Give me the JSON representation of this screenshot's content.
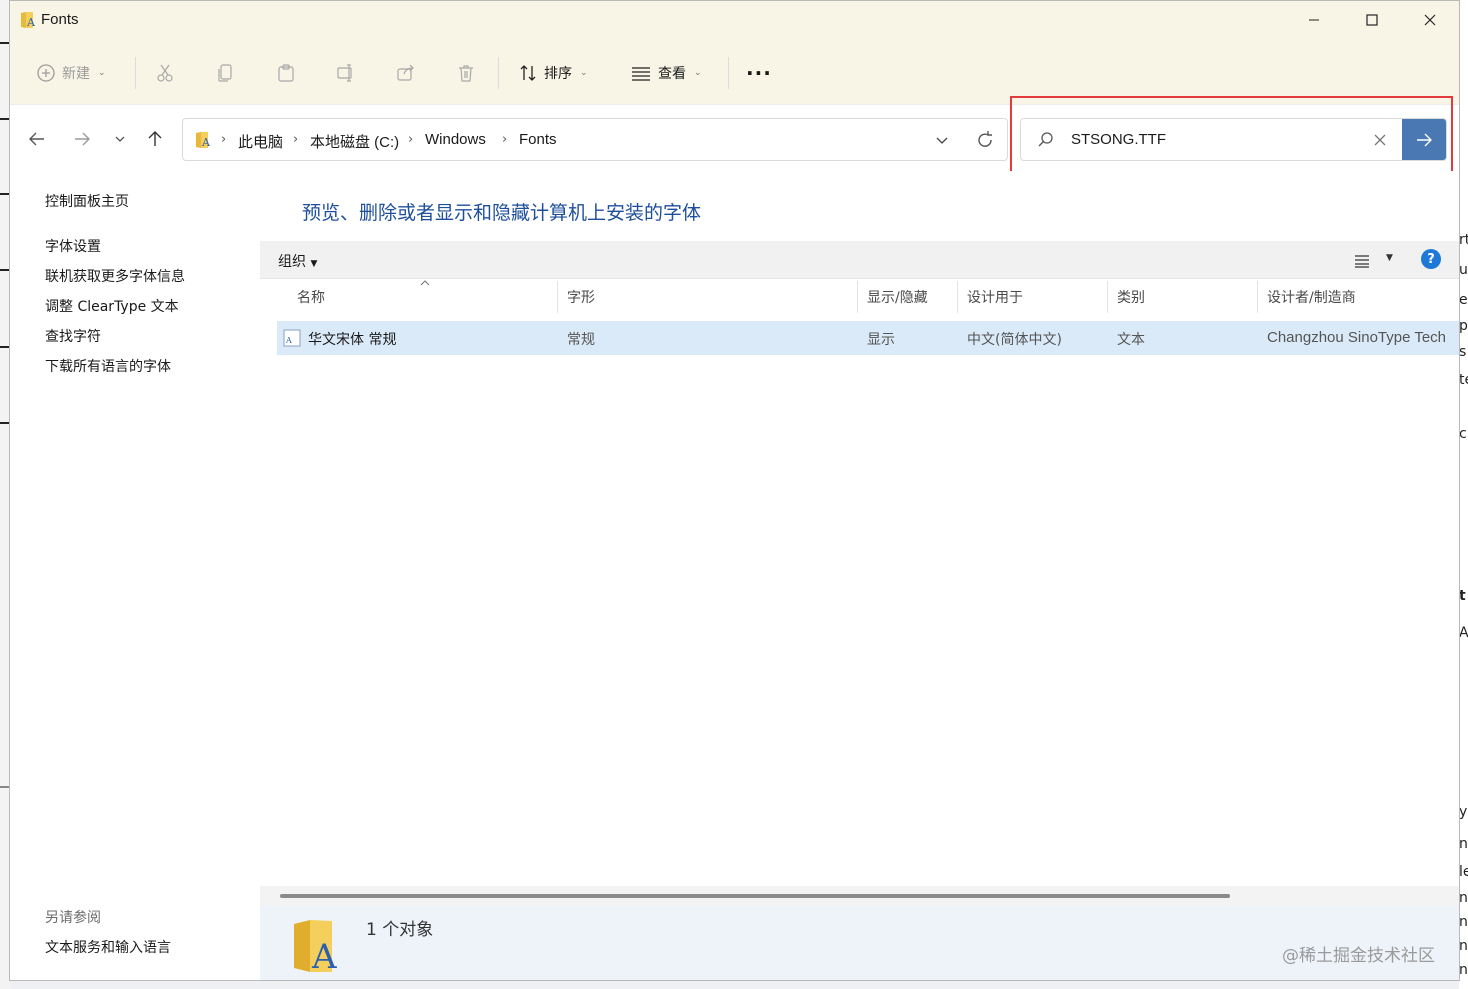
{
  "window": {
    "title": "Fonts",
    "minimize_glyph": "—",
    "maximize_glyph": "☐",
    "close_glyph": "✕"
  },
  "toolbar": {
    "new_label": "新建",
    "sort_label": "排序",
    "view_label": "查看",
    "more_glyph": "···"
  },
  "address": {
    "segments": [
      "此电脑",
      "本地磁盘 (C:)",
      "Windows",
      "Fonts"
    ],
    "separator": "›"
  },
  "search": {
    "value": "STSONG.TTF"
  },
  "sidebar": {
    "home": "控制面板主页",
    "items": [
      "字体设置",
      "联机获取更多字体信息",
      "调整 ClearType 文本",
      "查找字符",
      "下载所有语言的字体"
    ],
    "see_also_title": "另请参阅",
    "see_also_items": [
      "文本服务和输入语言"
    ]
  },
  "content": {
    "headline": "预览、删除或者显示和隐藏计算机上安装的字体",
    "organize_label": "组织",
    "help_glyph": "?",
    "columns": [
      "名称",
      "字形",
      "显示/隐藏",
      "设计用于",
      "类别",
      "设计者/制造商"
    ],
    "rows": [
      {
        "name": "华文宋体 常规",
        "style": "常规",
        "visibility": "显示",
        "designed_for": "中文(简体中文)",
        "category": "文本",
        "designer": "Changzhou SinoType Tech"
      }
    ]
  },
  "status": {
    "count_text": "1 个对象",
    "watermark": "@稀土掘金技术社区"
  },
  "right_edge": {
    "letters": [
      "rt",
      "u",
      "e",
      "pe",
      "s",
      "te",
      "c",
      "t",
      "A",
      "y",
      "n",
      "le",
      "n",
      "ni",
      "n",
      "na"
    ]
  },
  "colors": {
    "accent": "#4a78b3",
    "headline": "#1e4f9c",
    "selection": "#dbeaf8",
    "highlight_border": "#e23b3b",
    "titlebar": "#f8f5e6"
  },
  "icons": {
    "app": "font-folder-icon",
    "search": "search-icon",
    "go": "arrow-right-icon",
    "help": "help-icon"
  }
}
